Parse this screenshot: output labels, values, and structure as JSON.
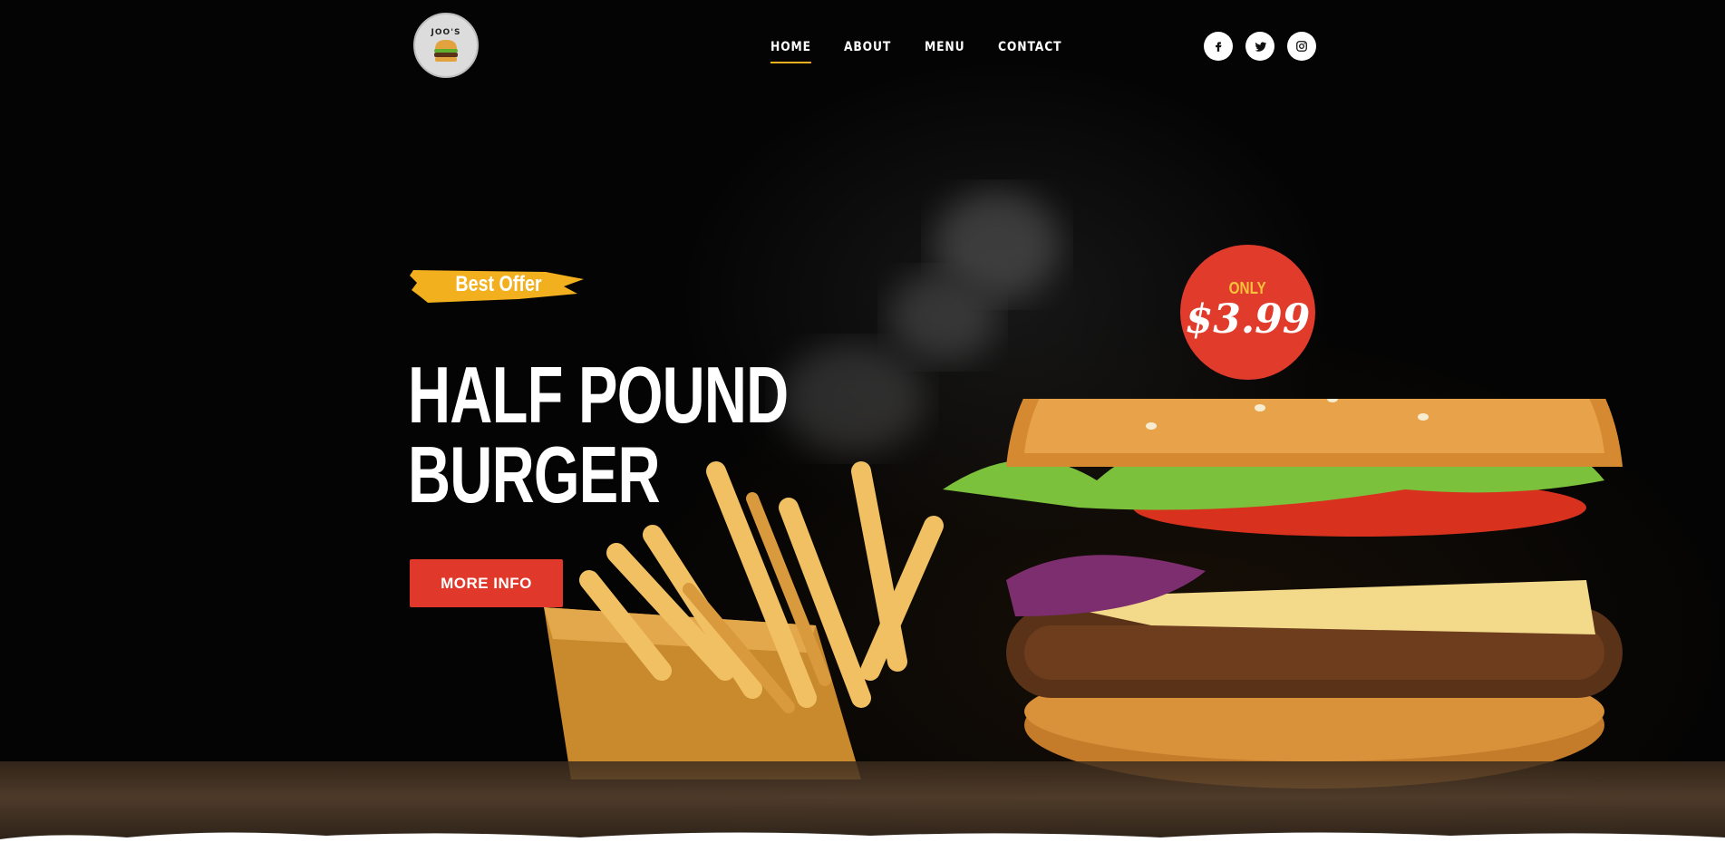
{
  "brand": {
    "logo_text": "JOO'S",
    "logo_icon": "burger-icon"
  },
  "nav": {
    "items": [
      {
        "label": "HOME",
        "active": true
      },
      {
        "label": "ABOUT",
        "active": false
      },
      {
        "label": "MENU",
        "active": false
      },
      {
        "label": "CONTACT",
        "active": false
      }
    ]
  },
  "social": [
    {
      "icon": "facebook-icon"
    },
    {
      "icon": "twitter-icon"
    },
    {
      "icon": "instagram-icon"
    }
  ],
  "hero": {
    "badge": "Best Offer",
    "title_line1": "HALF POUND",
    "title_line2": "BURGER",
    "cta_label": "MORE INFO",
    "price_label": "ONLY",
    "price_value": "$3.99"
  },
  "colors": {
    "accent_red": "#e0382b",
    "accent_yellow": "#f2b01e",
    "background": "#040404"
  }
}
